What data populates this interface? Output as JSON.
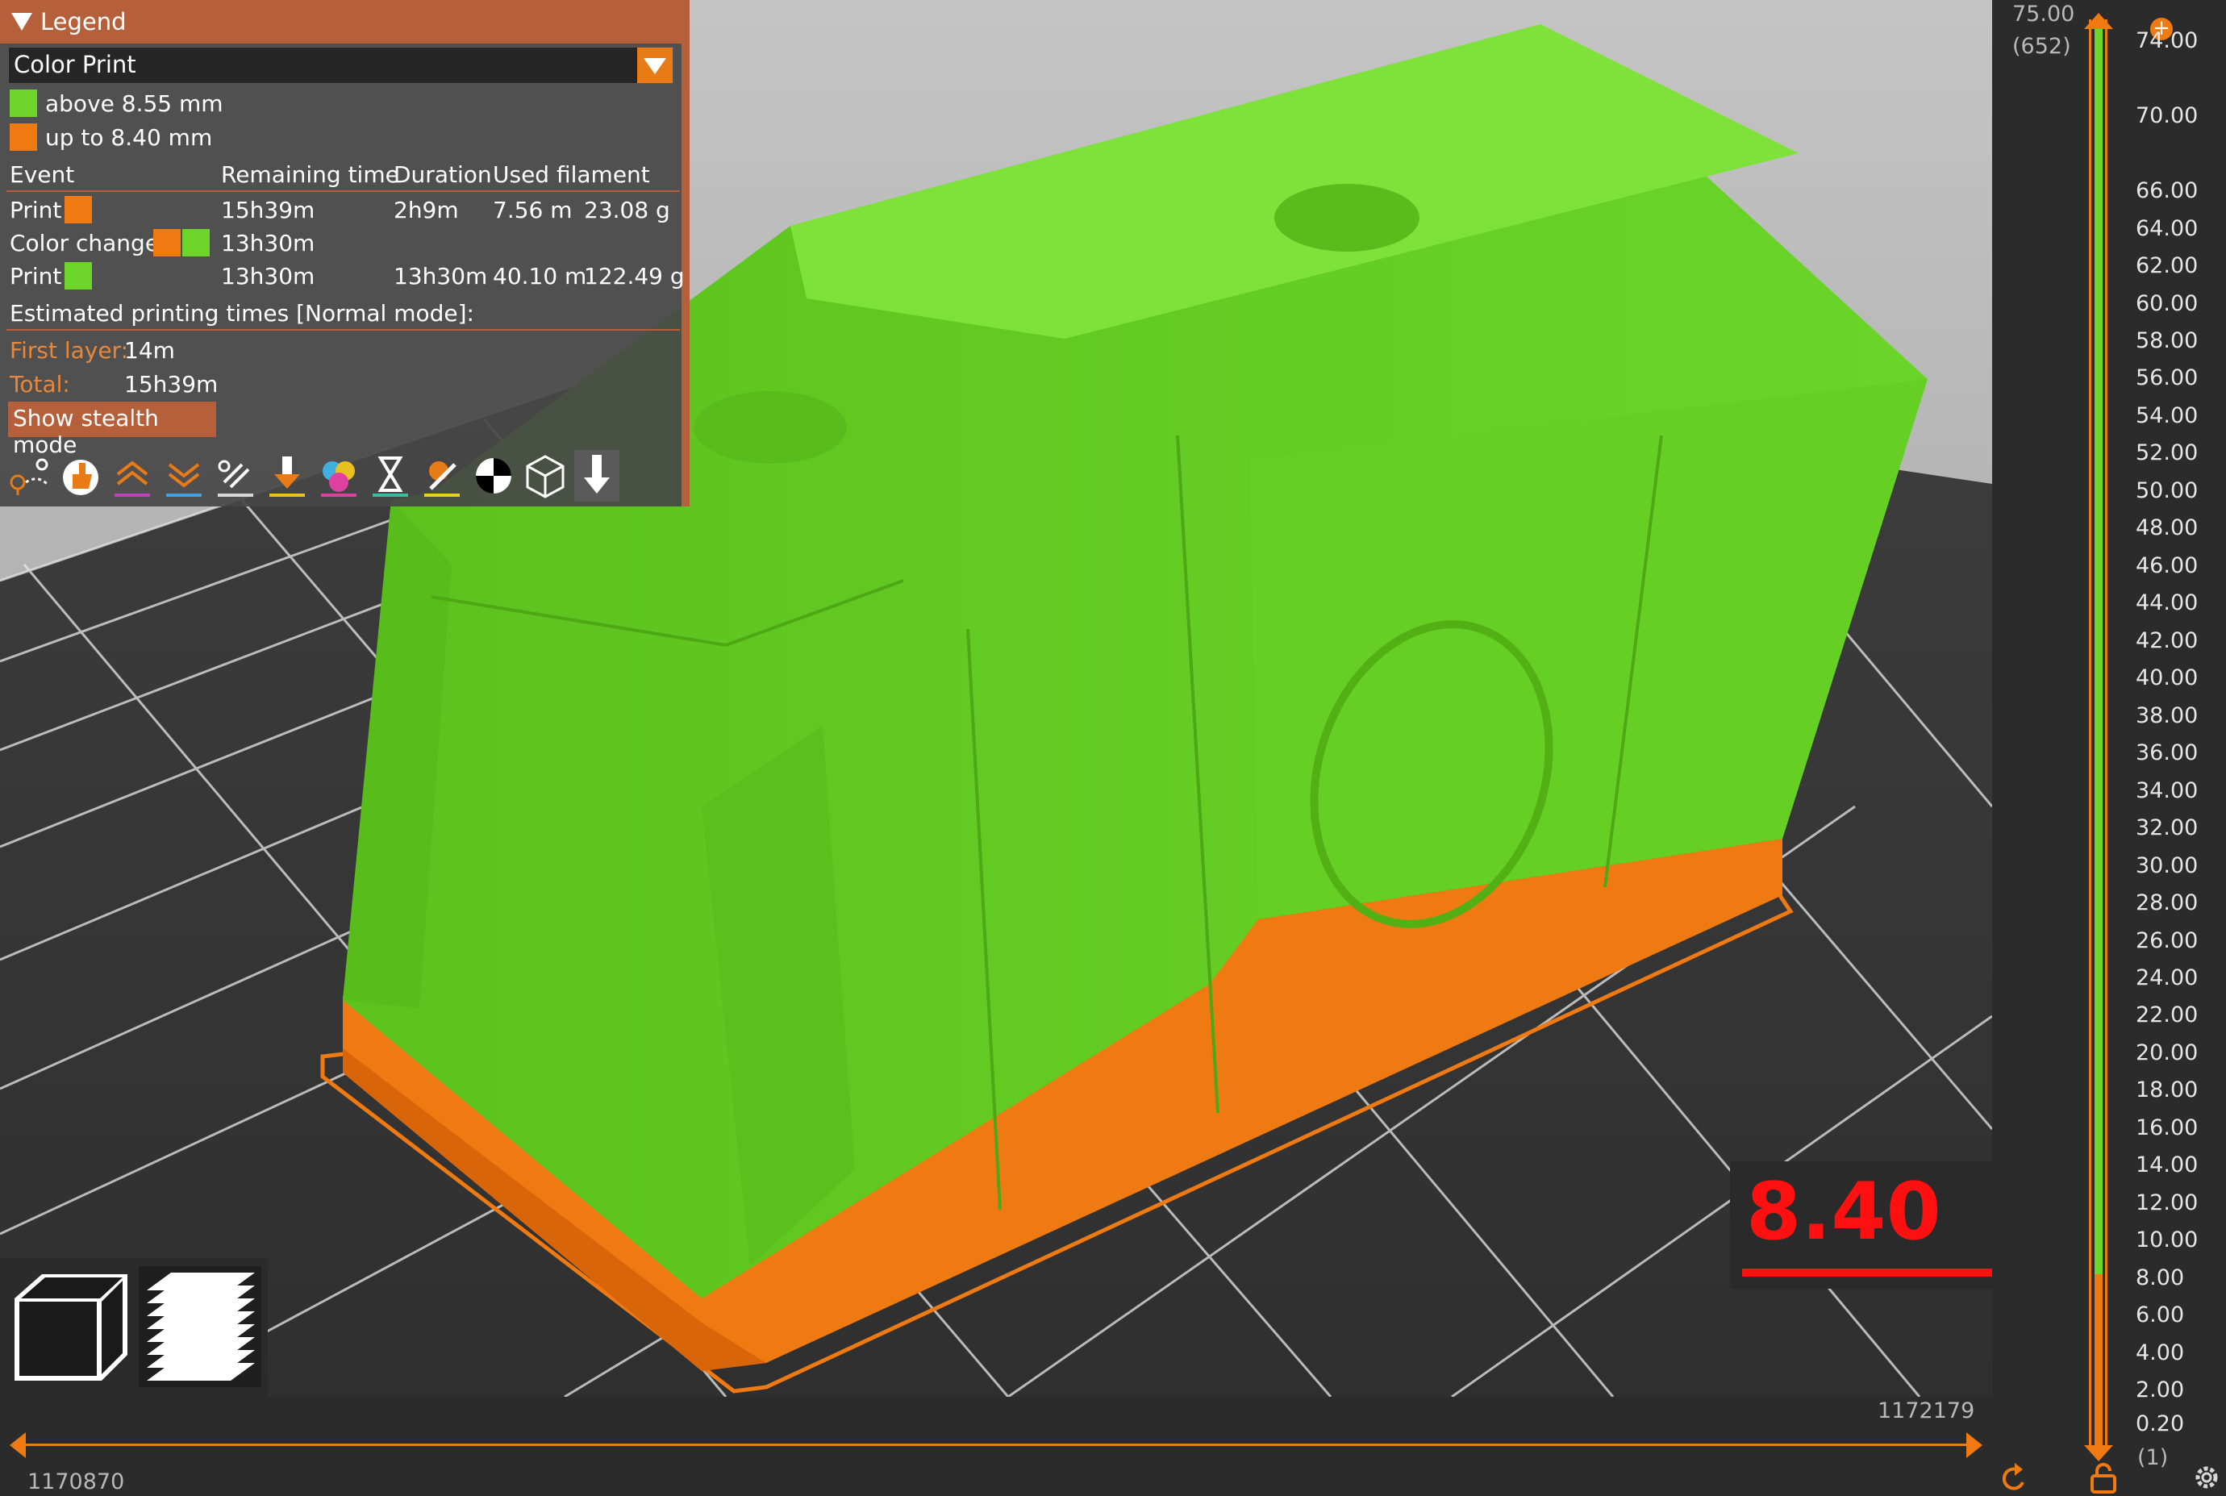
{
  "legend": {
    "title": "Legend",
    "view_type": "Color Print",
    "color_items": [
      {
        "label": "above 8.55 mm",
        "color": "#6ed62a"
      },
      {
        "label": "up to 8.40 mm",
        "color": "#ef7a12"
      }
    ],
    "table_headers": {
      "event": "Event",
      "remaining": "Remaining time",
      "duration": "Duration",
      "used": "Used filament"
    },
    "rows": [
      {
        "event": "Print",
        "remaining": "15h39m",
        "duration": "2h9m",
        "length": "7.56 m",
        "weight": "23.08 g"
      },
      {
        "event": "Color change",
        "remaining": "13h30m",
        "duration": "",
        "length": "",
        "weight": ""
      },
      {
        "event": "Print",
        "remaining": "13h30m",
        "duration": "13h30m",
        "length": "40.10 m",
        "weight": "122.49 g"
      }
    ],
    "estimated_label": "Estimated printing times [Normal mode]:",
    "first_layer_label": "First layer:",
    "first_layer_value": "14m",
    "total_label": "Total:",
    "total_value": "15h39m",
    "stealth_button": "Show stealth mode"
  },
  "toolbar_icons": [
    "travel-icon",
    "wipe-icon",
    "retractions-icon",
    "deretractions-icon",
    "seams-icon",
    "tool-changes-icon",
    "color-changes-icon",
    "pause-prints-icon",
    "custom-gcodes-icon",
    "center-of-gravity-icon",
    "shells-icon",
    "tool-marker-icon"
  ],
  "vertical_slider": {
    "top_value": "75.00",
    "top_layer": "(652)",
    "ticks": [
      "74.00",
      "70.00",
      "66.00",
      "64.00",
      "62.00",
      "60.00",
      "58.00",
      "56.00",
      "54.00",
      "52.00",
      "50.00",
      "48.00",
      "46.00",
      "44.00",
      "42.00",
      "40.00",
      "38.00",
      "36.00",
      "34.00",
      "32.00",
      "30.00",
      "28.00",
      "26.00",
      "24.00",
      "22.00",
      "20.00",
      "18.00",
      "16.00",
      "14.00",
      "12.00",
      "10.00",
      "8.00",
      "6.00",
      "4.00",
      "2.00",
      "0.20"
    ],
    "bottom_layer": "(1)",
    "current_height": "8.40"
  },
  "horizontal_slider": {
    "right_value": "1172179",
    "left_value": "1170870"
  },
  "colors": {
    "green": "#6ed62a",
    "orange": "#ef7a12",
    "accent": "#e87b16"
  }
}
